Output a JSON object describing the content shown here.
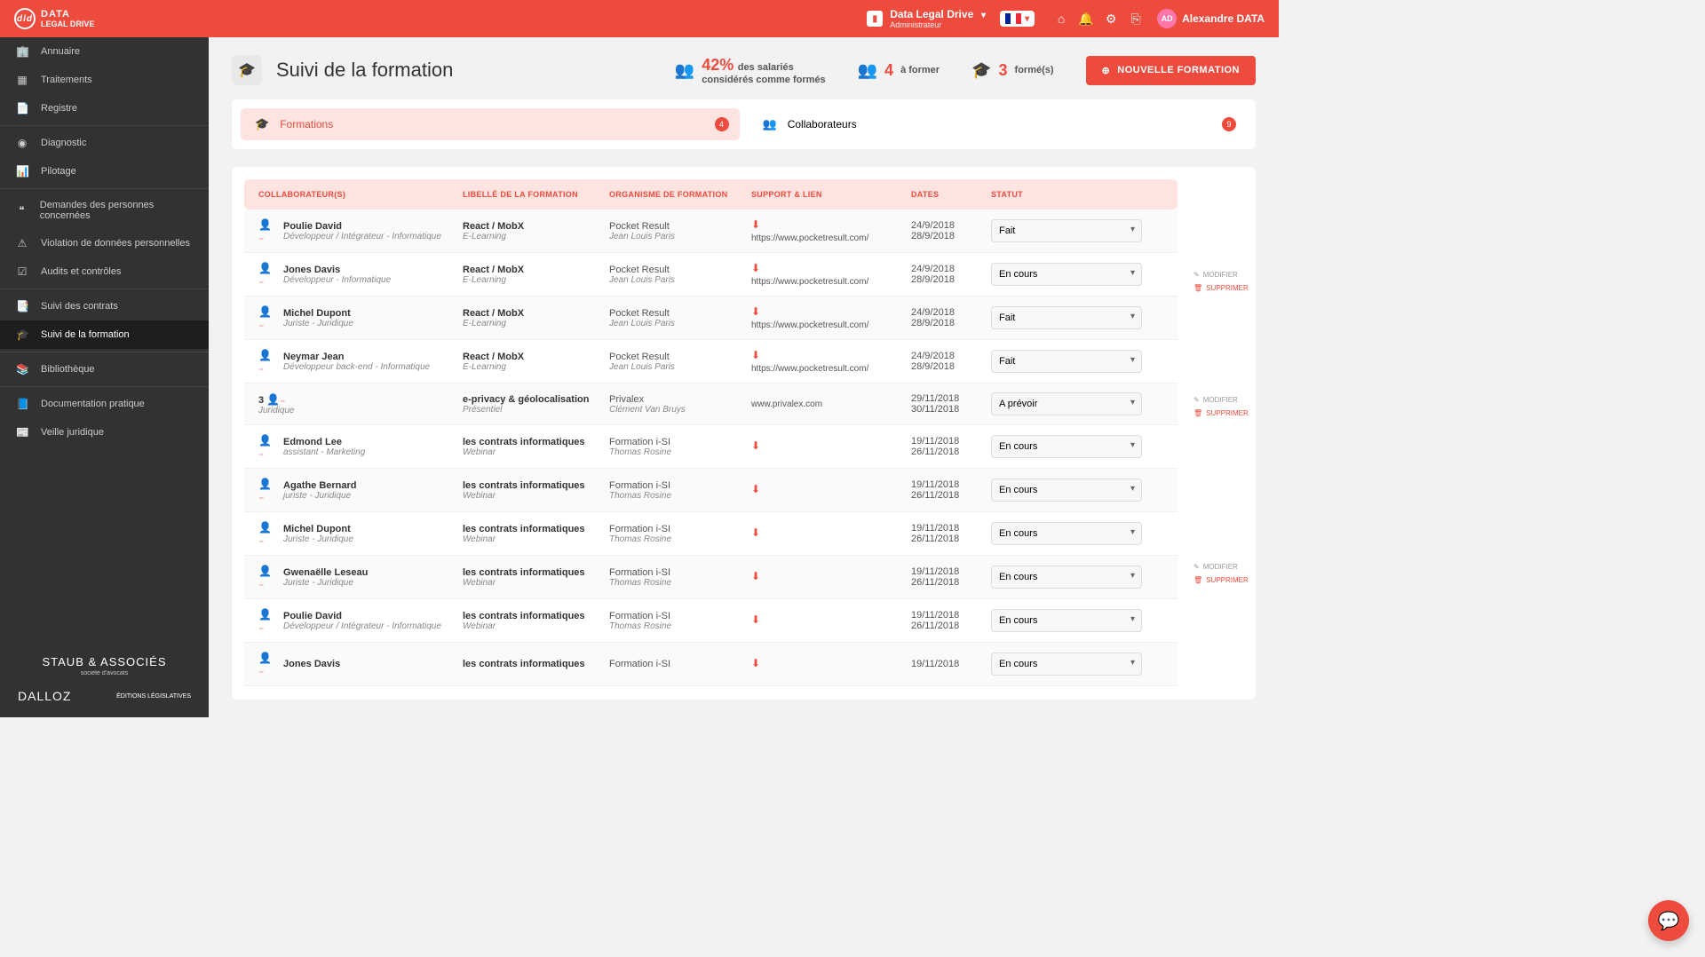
{
  "header": {
    "brand_line1": "DATA",
    "brand_line2": "LEGAL",
    "brand_line3": "DRIVE",
    "org_name": "Data Legal Drive",
    "org_role": "Administrateur",
    "user_initials": "AD",
    "user_name": "Alexandre DATA"
  },
  "sidebar": {
    "items": [
      {
        "icon": "🏢",
        "label": "Annuaire"
      },
      {
        "icon": "▦",
        "label": "Traitements"
      },
      {
        "icon": "📄",
        "label": "Registre"
      },
      {
        "icon": "◉",
        "label": "Diagnostic"
      },
      {
        "icon": "📊",
        "label": "Pilotage"
      },
      {
        "icon": "❝",
        "label": "Demandes des personnes concernées"
      },
      {
        "icon": "⚠",
        "label": "Violation de données personnelles"
      },
      {
        "icon": "☑",
        "label": "Audits et contrôles"
      },
      {
        "icon": "📑",
        "label": "Suivi des contrats"
      },
      {
        "icon": "🎓",
        "label": "Suivi de la formation"
      },
      {
        "icon": "📚",
        "label": "Bibliothèque"
      },
      {
        "icon": "📘",
        "label": "Documentation pratique"
      },
      {
        "icon": "📰",
        "label": "Veille juridique"
      }
    ],
    "footer": {
      "partner1": "STAUB & ASSOCIÉS",
      "partner1_sub": "société d'avocats",
      "partner2": "DALLOZ",
      "partner3": "ÉDITIONS LÉGISLATIVES"
    }
  },
  "page": {
    "title": "Suivi de la formation",
    "stat1_value": "42%",
    "stat1_line1": "des salariés",
    "stat1_line2": "considérés comme formés",
    "stat2_value": "4",
    "stat2_label": "à former",
    "stat3_value": "3",
    "stat3_label": "formé(s)",
    "new_button": "NOUVELLE FORMATION"
  },
  "tabs": {
    "formations_label": "Formations",
    "formations_count": "4",
    "collab_label": "Collaborateurs",
    "collab_count": "9"
  },
  "table": {
    "headers": {
      "collab": "COLLABORATEUR(S)",
      "libelle": "LIBELLÉ DE LA FORMATION",
      "organisme": "ORGANISME DE FORMATION",
      "support": "SUPPORT & LIEN",
      "dates": "DATES",
      "statut": "STATUT"
    },
    "actions": {
      "edit": "MODIFIER",
      "delete": "SUPPRIMER"
    },
    "rows": [
      {
        "name": "Poulie David",
        "role": "Développeur / Intégrateur - Informatique",
        "course": "React / MobX",
        "mode": "E-Learning",
        "org": "Pocket Result",
        "org_contact": "Jean Louis Paris",
        "link": "https://www.pocketresult.com/",
        "date1": "24/9/2018",
        "date2": "28/9/2018",
        "status": "Fait",
        "show_actions": false,
        "dl": true
      },
      {
        "name": "Jones Davis",
        "role": "Développeur - Informatique",
        "course": "React / MobX",
        "mode": "E-Learning",
        "org": "Pocket Result",
        "org_contact": "Jean Louis Paris",
        "link": "https://www.pocketresult.com/",
        "date1": "24/9/2018",
        "date2": "28/9/2018",
        "status": "En cours",
        "show_actions": true,
        "dl": true
      },
      {
        "name": "Michel Dupont",
        "role": "Juriste - Juridique",
        "course": "React / MobX",
        "mode": "E-Learning",
        "org": "Pocket Result",
        "org_contact": "Jean Louis Paris",
        "link": "https://www.pocketresult.com/",
        "date1": "24/9/2018",
        "date2": "28/9/2018",
        "status": "Fait",
        "show_actions": false,
        "dl": true
      },
      {
        "name": "Neymar Jean",
        "role": "Développeur back-end - Informatique",
        "course": "React / MobX",
        "mode": "E-Learning",
        "org": "Pocket Result",
        "org_contact": "Jean Louis Paris",
        "link": "https://www.pocketresult.com/",
        "date1": "24/9/2018",
        "date2": "28/9/2018",
        "status": "Fait",
        "show_actions": false,
        "dl": true
      },
      {
        "count_label": "3",
        "role": "Juridique",
        "course": "e-privacy & géolocalisation",
        "mode": "Présentiel",
        "org": "Privalex",
        "org_contact": "Clément Van Bruys",
        "link": "www.privalex.com",
        "date1": "29/11/2018",
        "date2": "30/11/2018",
        "status": "A prévoir",
        "show_actions": true,
        "dl": false,
        "group": true
      },
      {
        "name": "Edmond Lee",
        "role": "assistant - Marketing",
        "course": "les contrats informatiques",
        "mode": "Webinar",
        "org": "Formation i-SI",
        "org_contact": "Thomas Rosine",
        "link": "",
        "date1": "19/11/2018",
        "date2": "26/11/2018",
        "status": "En cours",
        "show_actions": false,
        "dl": true
      },
      {
        "name": "Agathe Bernard",
        "role": "juriste - Juridique",
        "course": "les contrats informatiques",
        "mode": "Webinar",
        "org": "Formation i-SI",
        "org_contact": "Thomas Rosine",
        "link": "",
        "date1": "19/11/2018",
        "date2": "26/11/2018",
        "status": "En cours",
        "show_actions": false,
        "dl": true
      },
      {
        "name": "Michel Dupont",
        "role": "Juriste - Juridique",
        "course": "les contrats informatiques",
        "mode": "Webinar",
        "org": "Formation i-SI",
        "org_contact": "Thomas Rosine",
        "link": "",
        "date1": "19/11/2018",
        "date2": "26/11/2018",
        "status": "En cours",
        "show_actions": false,
        "dl": true
      },
      {
        "name": "Gwenaëlle Leseau",
        "role": "Juriste - Juridique",
        "course": "les contrats informatiques",
        "mode": "Webinar",
        "org": "Formation i-SI",
        "org_contact": "Thomas Rosine",
        "link": "",
        "date1": "19/11/2018",
        "date2": "26/11/2018",
        "status": "En cours",
        "show_actions": true,
        "dl": true
      },
      {
        "name": "Poulie David",
        "role": "Développeur / Intégrateur - Informatique",
        "course": "les contrats informatiques",
        "mode": "Webinar",
        "org": "Formation i-SI",
        "org_contact": "Thomas Rosine",
        "link": "",
        "date1": "19/11/2018",
        "date2": "26/11/2018",
        "status": "En cours",
        "show_actions": false,
        "dl": true
      },
      {
        "name": "Jones Davis",
        "role": "",
        "course": "les contrats informatiques",
        "mode": "",
        "org": "Formation i-SI",
        "org_contact": "",
        "link": "",
        "date1": "19/11/2018",
        "date2": "",
        "status": "En cours",
        "show_actions": false,
        "dl": true
      }
    ]
  }
}
